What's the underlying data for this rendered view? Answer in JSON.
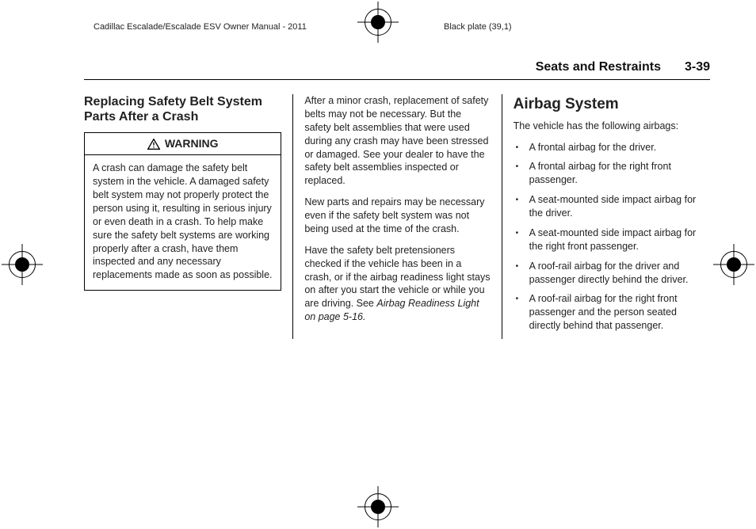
{
  "running_head_left": "Cadillac Escalade/Escalade ESV Owner Manual - 2011",
  "running_head_right": "Black plate (39,1)",
  "section_name": "Seats and Restraints",
  "page_number": "3-39",
  "col1": {
    "heading": "Replacing Safety Belt System Parts After a Crash",
    "warning_label": "WARNING",
    "warning_body": "A crash can damage the safety belt system in the vehicle. A damaged safety belt system may not properly protect the person using it, resulting in serious injury or even death in a crash. To help make sure the safety belt systems are working properly after a crash, have them inspected and any necessary replacements made as soon as possible."
  },
  "col2": {
    "p1": "After a minor crash, replacement of safety belts may not be necessary. But the safety belt assemblies that were used during any crash may have been stressed or damaged. See your dealer to have the safety belt assemblies inspected or replaced.",
    "p2": "New parts and repairs may be necessary even if the safety belt system was not being used at the time of the crash.",
    "p3_prefix": "Have the safety belt pretensioners checked if the vehicle has been in a crash, or if the airbag readiness light stays on after you start the vehicle or while you are driving. See ",
    "p3_ref": "Airbag Readiness Light on page 5‑16."
  },
  "col3": {
    "heading": "Airbag System",
    "intro": "The vehicle has the following airbags:",
    "bullets": [
      "A frontal airbag for the driver.",
      "A frontal airbag for the right front passenger.",
      "A seat-mounted side impact airbag for the driver.",
      "A seat-mounted side impact airbag for the right front passenger.",
      "A roof-rail airbag for the driver and passenger directly behind the driver.",
      "A roof-rail airbag for the right front passenger and the person seated directly behind that passenger."
    ]
  }
}
